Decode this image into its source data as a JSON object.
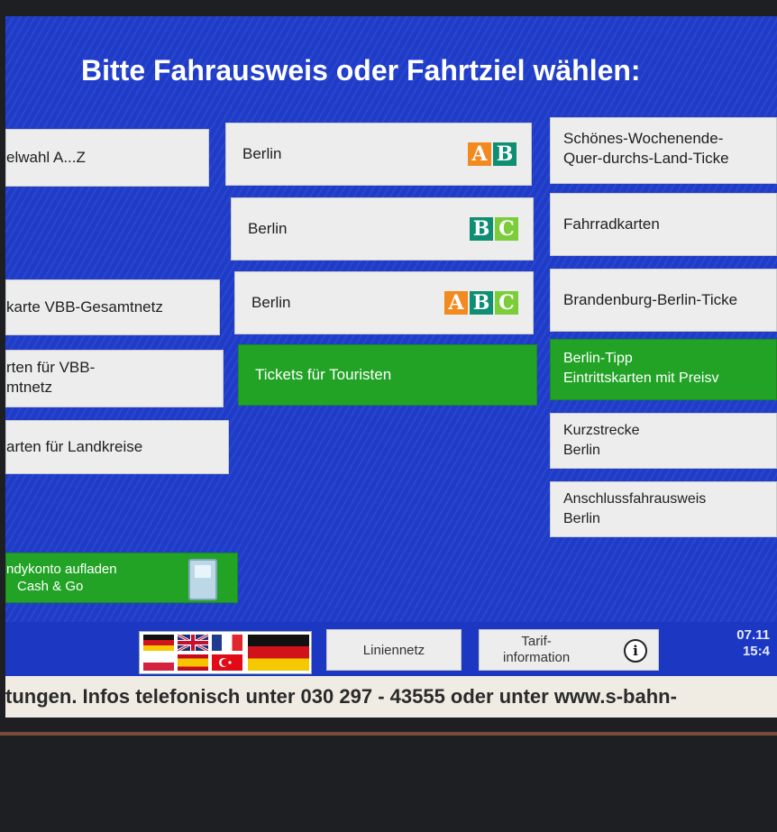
{
  "title": "Bitte Fahrausweis oder Fahrtziel wählen:",
  "left_column": [
    {
      "label": "elwahl A...Z"
    },
    {
      "label": "karte VBB-Gesamtnetz"
    },
    {
      "line1": "rten für VBB-",
      "line2": "mtnetz"
    },
    {
      "label": "arten für Landkreise"
    },
    {
      "line1": "ndykonto aufladen",
      "line2": "Cash & Go"
    }
  ],
  "middle_column": [
    {
      "label": "Berlin",
      "zones": [
        "A",
        "B"
      ]
    },
    {
      "label": "Berlin",
      "zones": [
        "B",
        "C"
      ]
    },
    {
      "label": "Berlin",
      "zones": [
        "A",
        "B",
        "C"
      ]
    },
    {
      "label": "Tickets für Touristen"
    }
  ],
  "right_column": [
    {
      "line1": "Schönes-Wochenende-",
      "line2": "Quer-durchs-Land-Ticke"
    },
    {
      "label": "Fahrradkarten"
    },
    {
      "label": "Brandenburg-Berlin-Ticke"
    },
    {
      "line1": "Berlin-Tipp",
      "line2": "Eintrittskarten mit Preisv"
    },
    {
      "line1": "Kurzstrecke",
      "line2": "Berlin"
    },
    {
      "line1": "Anschlussfahrausweis",
      "line2": "Berlin"
    }
  ],
  "bottom": {
    "liniennetz": "Liniennetz",
    "tarif_line1": "Tarif-",
    "tarif_line2": "information",
    "info_glyph": "i",
    "date": "07.11",
    "time": "15:4"
  },
  "ticker": "tungen. Infos telefonisch unter 030 297 - 43555 oder unter www.s-bahn-",
  "colors": {
    "screen_blue": "#1f3cc9",
    "button_grey": "#ededed",
    "button_green": "#22a326",
    "zone_A": "#f38a20",
    "zone_B": "#0e8e72",
    "zone_C": "#7ccd3a"
  }
}
